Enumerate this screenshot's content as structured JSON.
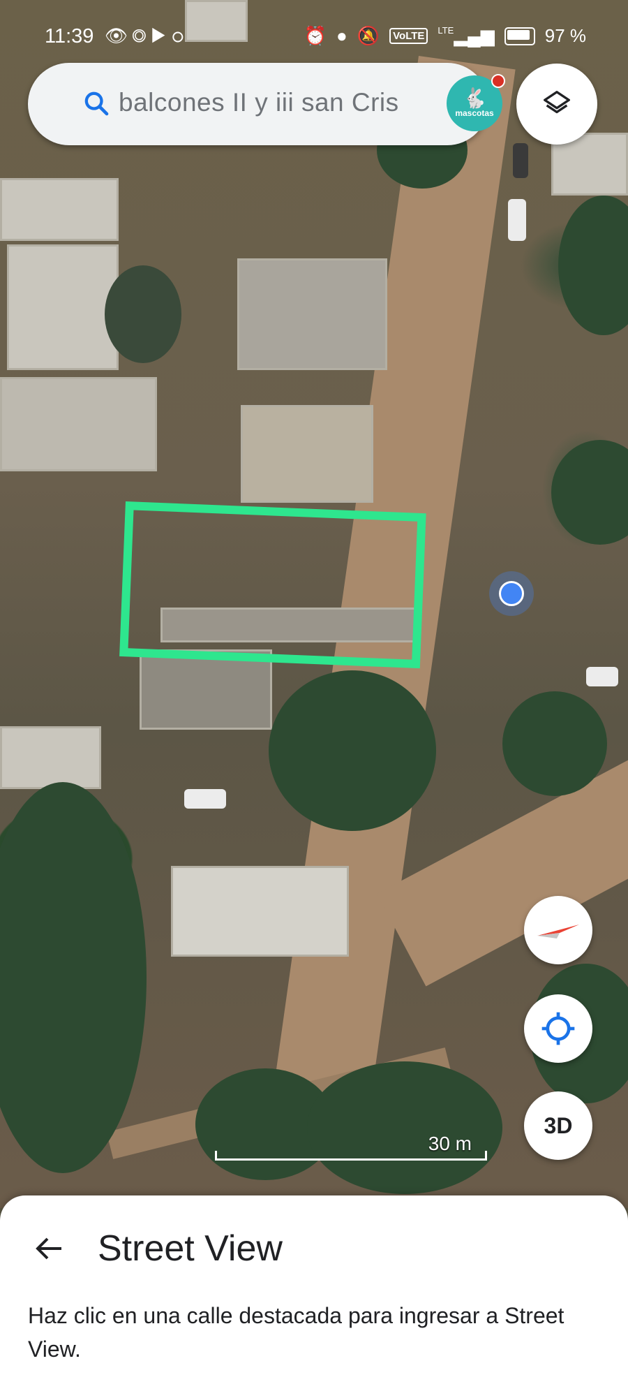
{
  "status_bar": {
    "time": "11:39",
    "left_icons": [
      "eye-icon",
      "whatsapp-icon",
      "youtube-icon",
      "voicemail-icon"
    ],
    "right_icons": [
      "alarm-icon",
      "location-icon",
      "mute-icon"
    ],
    "volte": "VoLTE",
    "network": "LTE",
    "battery": "97 %"
  },
  "search": {
    "query": "balcones II y iii san Cris",
    "avatar_text": "mascotas"
  },
  "map": {
    "scale_label": "30 m",
    "three_d_label": "3D",
    "selection_color": "#2ee68e",
    "location_color": "#4285f4"
  },
  "sheet": {
    "title": "Street View",
    "description": "Haz clic en una calle destacada para ingresar a Street View."
  }
}
